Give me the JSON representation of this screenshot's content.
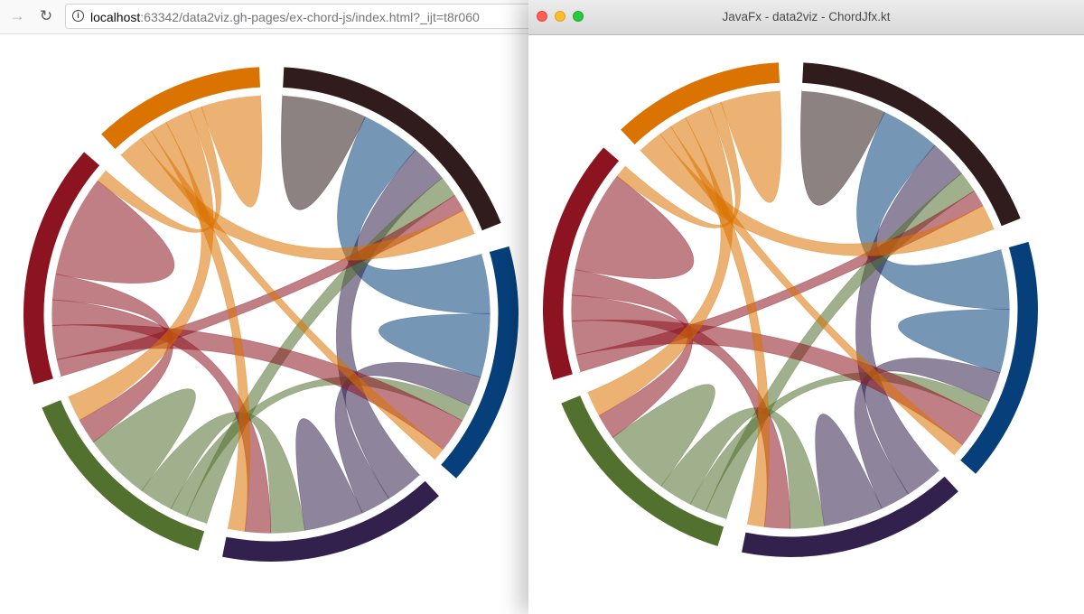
{
  "browser": {
    "toolbar": {
      "forward_icon": "→",
      "reload_icon": "↻",
      "info_icon": "i",
      "url_host": "localhost",
      "url_rest": ":63342/data2viz.gh-pages/ex-chord-js/index.html?_ijt=t8r060"
    }
  },
  "jfx_window": {
    "title": "JavaFx - data2viz - ChordJfx.kt"
  },
  "chart_data": {
    "type": "chord",
    "group_colors": [
      "#301c1c",
      "#063f7a",
      "#32204d",
      "#52702e",
      "#8c1420",
      "#db7300"
    ],
    "groups": [
      {
        "index": 0,
        "color": "#301c1c"
      },
      {
        "index": 1,
        "color": "#063f7a"
      },
      {
        "index": 2,
        "color": "#32204d"
      },
      {
        "index": 3,
        "color": "#52702e"
      },
      {
        "index": 4,
        "color": "#8c1420"
      },
      {
        "index": 5,
        "color": "#db7300"
      }
    ],
    "ribbons": [
      {
        "source": 0,
        "target": 0,
        "value": 20
      },
      {
        "source": 0,
        "target": 1,
        "value": 14
      },
      {
        "source": 0,
        "target": 2,
        "value": 9
      },
      {
        "source": 0,
        "target": 3,
        "value": 5
      },
      {
        "source": 0,
        "target": 4,
        "value": 4
      },
      {
        "source": 0,
        "target": 5,
        "value": 6
      },
      {
        "source": 1,
        "target": 1,
        "value": 15
      },
      {
        "source": 1,
        "target": 2,
        "value": 7
      },
      {
        "source": 1,
        "target": 3,
        "value": 4
      },
      {
        "source": 1,
        "target": 4,
        "value": 8
      },
      {
        "source": 1,
        "target": 5,
        "value": 3
      },
      {
        "source": 2,
        "target": 2,
        "value": 14
      },
      {
        "source": 2,
        "target": 3,
        "value": 8
      },
      {
        "source": 2,
        "target": 4,
        "value": 6
      },
      {
        "source": 2,
        "target": 5,
        "value": 4
      },
      {
        "source": 3,
        "target": 3,
        "value": 16
      },
      {
        "source": 3,
        "target": 4,
        "value": 6
      },
      {
        "source": 3,
        "target": 5,
        "value": 6
      },
      {
        "source": 4,
        "target": 4,
        "value": 24
      },
      {
        "source": 4,
        "target": 5,
        "value": 3
      },
      {
        "source": 5,
        "target": 5,
        "value": 14
      }
    ],
    "pad_angle": 0.1
  }
}
